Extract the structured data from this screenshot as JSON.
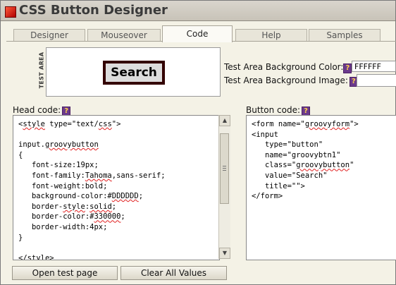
{
  "window": {
    "title": "CSS Button Designer"
  },
  "tabs": [
    {
      "label": "Designer",
      "active": false
    },
    {
      "label": "Mouseover",
      "active": false
    },
    {
      "label": "Code",
      "active": true
    },
    {
      "label": "Help",
      "active": false
    },
    {
      "label": "Samples",
      "active": false
    }
  ],
  "test_area": {
    "label": "TEST AREA",
    "button_value": "Search",
    "bg_color_label": "Test Area Background Color:",
    "bg_color_value": "FFFFFF",
    "bg_image_label": "Test Area Background Image:",
    "bg_image_value": ""
  },
  "head_code": {
    "label": "Head code:",
    "lines": [
      "<style type=\"text/css\">",
      "",
      "input.groovybutton",
      "{",
      "   font-size:19px;",
      "   font-family:Tahoma,sans-serif;",
      "   font-weight:bold;",
      "   background-color:#DDDDDD;",
      "   border-style:solid;",
      "   border-color:#330000;",
      "   border-width:4px;",
      "}",
      "",
      "</style>"
    ]
  },
  "button_code": {
    "label": "Button code:",
    "lines": [
      "<form name=\"groovyform\">",
      "<input",
      "   type=\"button\"",
      "   name=\"groovybtn1\"",
      "   class=\"groovybutton\"",
      "   value=\"Search\"",
      "   title=\"\">",
      "</form>"
    ]
  },
  "help_icon": "?",
  "actions": {
    "open_test_page": "Open test page",
    "clear_all": "Clear All Values"
  },
  "colors": {
    "help_bg": "#6b3a8c",
    "help_fg": "#ffd24a",
    "accent_red": "#c00000",
    "button_border": "#330000",
    "button_bg": "#DDDDDD"
  }
}
